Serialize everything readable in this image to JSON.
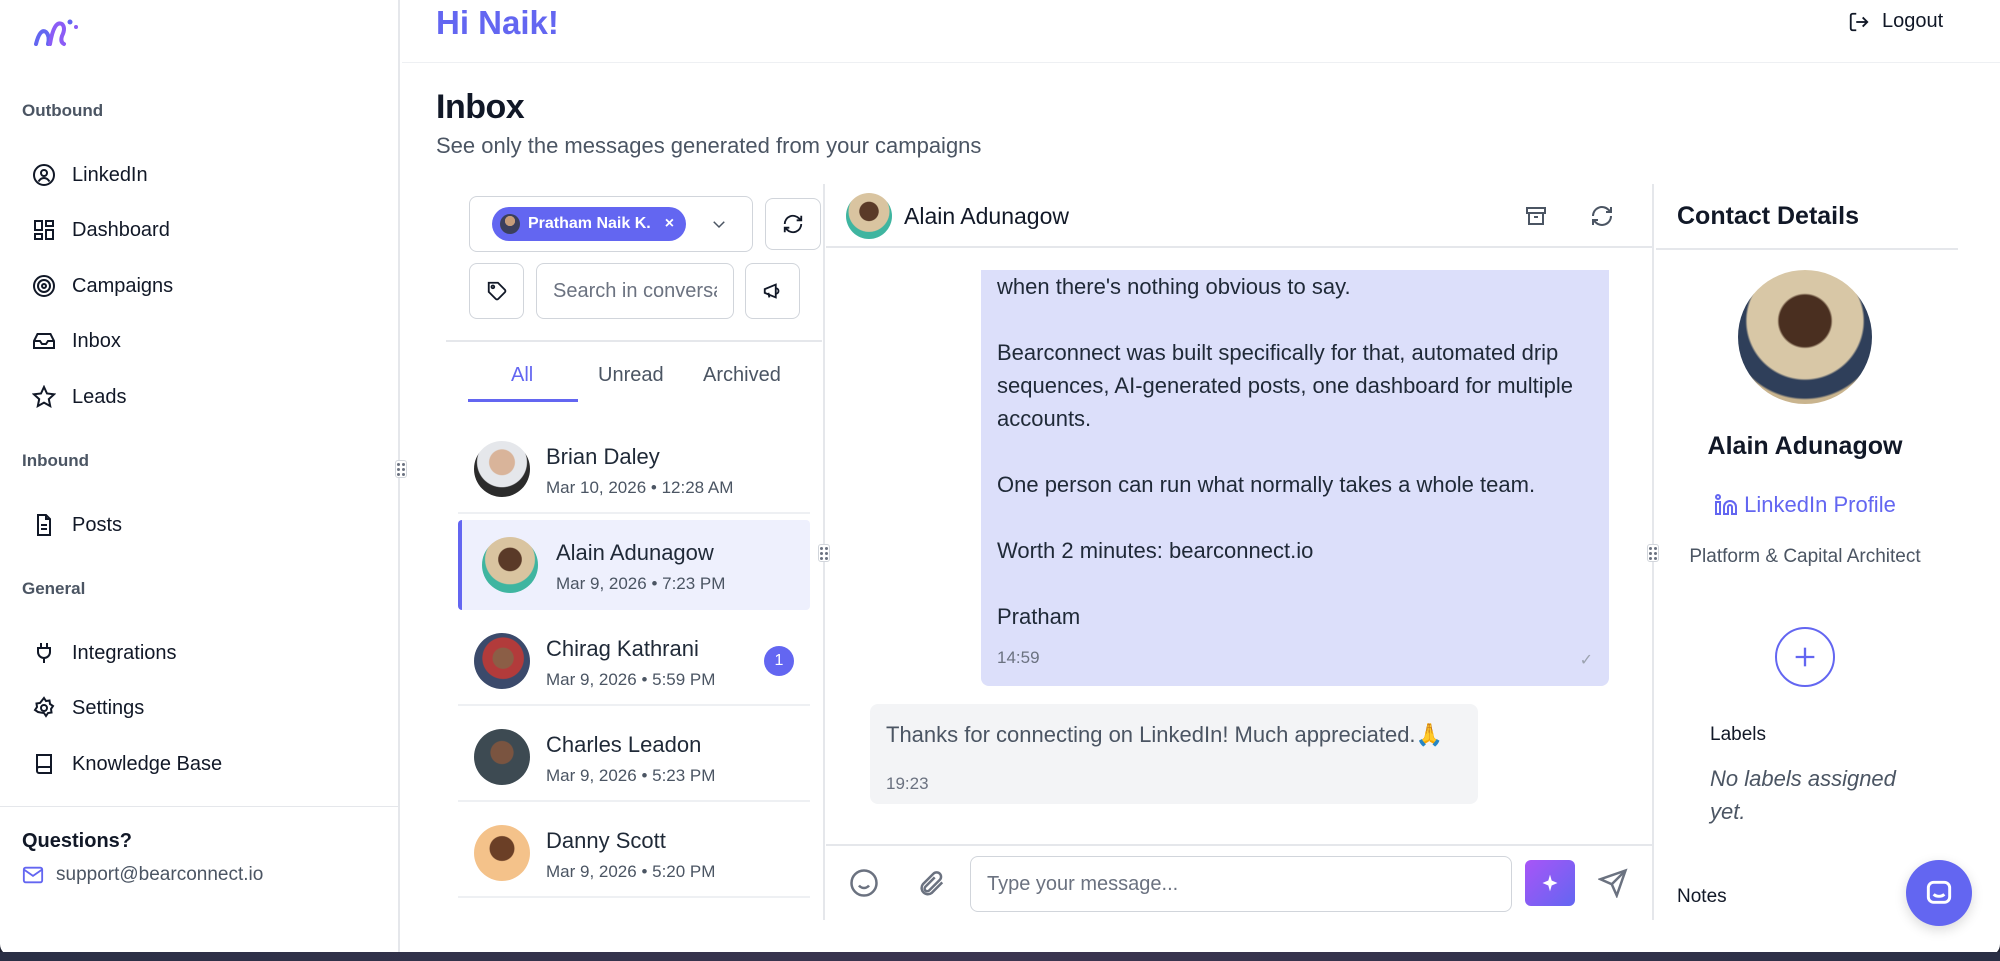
{
  "header": {
    "greeting": "Hi Naik!",
    "logout_label": "Logout"
  },
  "sidebar": {
    "sections": [
      "Outbound",
      "Inbound",
      "General"
    ],
    "items": [
      {
        "label": "LinkedIn",
        "icon": "user-circle-icon"
      },
      {
        "label": "Dashboard",
        "icon": "grid-icon"
      },
      {
        "label": "Campaigns",
        "icon": "target-icon"
      },
      {
        "label": "Inbox",
        "icon": "inbox-icon"
      },
      {
        "label": "Leads",
        "icon": "star-icon"
      },
      {
        "label": "Posts",
        "icon": "document-icon"
      },
      {
        "label": "Integrations",
        "icon": "plug-icon"
      },
      {
        "label": "Settings",
        "icon": "gear-icon"
      },
      {
        "label": "Knowledge Base",
        "icon": "book-icon"
      }
    ],
    "questions": "Questions?",
    "support_email": "support@bearconnect.io"
  },
  "page": {
    "title": "Inbox",
    "subtitle": "See only the messages generated from your campaigns"
  },
  "filters": {
    "account_chip": "Pratham Naik K.",
    "search_placeholder": "Search in conversations",
    "tabs": [
      "All",
      "Unread",
      "Archived"
    ],
    "active_tab": "All"
  },
  "conversations": [
    {
      "name": "Brian Daley",
      "time": "Mar 10, 2026 • 12:28 AM",
      "unread": ""
    },
    {
      "name": "Alain Adunagow",
      "time": "Mar 9, 2026 • 7:23 PM",
      "unread": ""
    },
    {
      "name": "Chirag Kathrani",
      "time": "Mar 9, 2026 • 5:59 PM",
      "unread": "1"
    },
    {
      "name": "Charles Leadon",
      "time": "Mar 9, 2026 • 5:23 PM",
      "unread": ""
    },
    {
      "name": "Danny Scott",
      "time": "Mar 9, 2026 • 5:20 PM",
      "unread": ""
    }
  ],
  "chat": {
    "contact_name": "Alain Adunagow",
    "outgoing": {
      "paragraphs": [
        "when there's nothing obvious to say.",
        "Bearconnect was built specifically for that, automated drip sequences, AI-generated posts, one dashboard for multiple accounts.",
        "One person can run what normally takes a whole team.",
        "Worth 2 minutes: bearconnect.io",
        "Pratham"
      ],
      "time": "14:59",
      "status": "✓"
    },
    "incoming": {
      "text": "Thanks for connecting on LinkedIn! Much appreciated.🙏",
      "time": "19:23"
    },
    "input_placeholder": "Type your message..."
  },
  "contact": {
    "title": "Contact Details",
    "name": "Alain Adunagow",
    "linkedin_label": "LinkedIn Profile",
    "role": "Platform & Capital Architect",
    "labels_heading": "Labels",
    "labels_empty": "No labels assigned yet.",
    "notes_heading": "Notes"
  },
  "colors": {
    "accent": "#6366f1",
    "bubble_out": "#dcdffa",
    "bubble_in": "#f3f4f6"
  }
}
